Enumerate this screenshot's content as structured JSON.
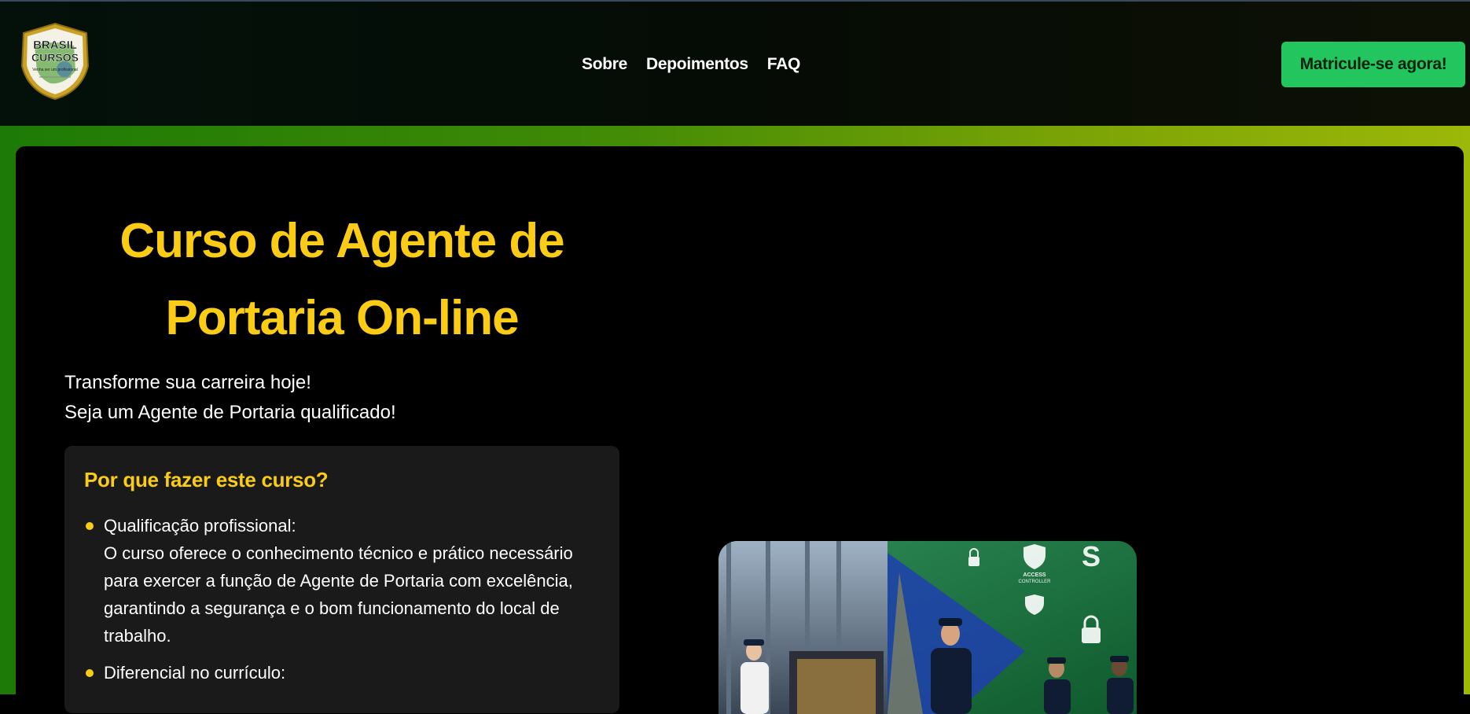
{
  "logo": {
    "line1": "BRASIL",
    "line2": "CURSOS",
    "slogan": "Venha ser um profissional"
  },
  "nav": {
    "items": [
      "Sobre",
      "Depoimentos",
      "FAQ"
    ]
  },
  "cta": {
    "label": "Matricule-se agora!"
  },
  "hero": {
    "title_line1": "Curso de Agente de",
    "title_line2": "Portaria On-line",
    "tagline_line1": "Transforme sua carreira hoje!",
    "tagline_line2": "Seja um Agente de Portaria qualificado!"
  },
  "why": {
    "heading": "Por que fazer este curso?",
    "items": [
      {
        "title": "Qualificação profissional:",
        "text": "O curso oferece o conhecimento técnico e prático necessário para exercer a função de Agente de Portaria com excelência, garantindo a segurança e o bom funcionamento do local de trabalho."
      },
      {
        "title": "Diferencial no currículo:",
        "text": ""
      }
    ]
  },
  "image": {
    "label1": "ACCESS",
    "label2": "CONTROLLER"
  },
  "colors": {
    "accent": "#facc15",
    "cta": "#22c55e",
    "background": "#000000",
    "card": "#1a1a1a"
  }
}
